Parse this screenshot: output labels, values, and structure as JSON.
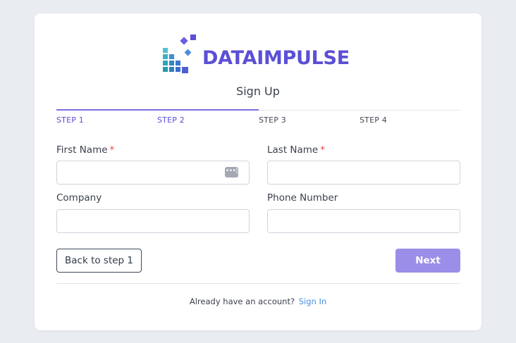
{
  "brand": {
    "name": "DATAIMPULSE",
    "color": "#5b4fd6",
    "accent_teal": "#2ab3c2"
  },
  "page": {
    "title": "Sign Up"
  },
  "steps": {
    "items": [
      {
        "label": "STEP 1",
        "state": "completed"
      },
      {
        "label": "STEP 2",
        "state": "current"
      },
      {
        "label": "STEP 3",
        "state": "upcoming"
      },
      {
        "label": "STEP 4",
        "state": "upcoming"
      }
    ],
    "progress_fraction": 0.5
  },
  "form": {
    "first_name": {
      "label": "First Name",
      "required_mark": "*",
      "value": ""
    },
    "last_name": {
      "label": "Last Name",
      "required_mark": "*",
      "value": ""
    },
    "company": {
      "label": "Company",
      "value": ""
    },
    "phone": {
      "label": "Phone Number",
      "value": ""
    },
    "autofill_icon": "password-manager-icon"
  },
  "actions": {
    "back_label": "Back to step 1",
    "next_label": "Next"
  },
  "footer": {
    "prompt": "Already have an account?",
    "link_label": "Sign In"
  }
}
